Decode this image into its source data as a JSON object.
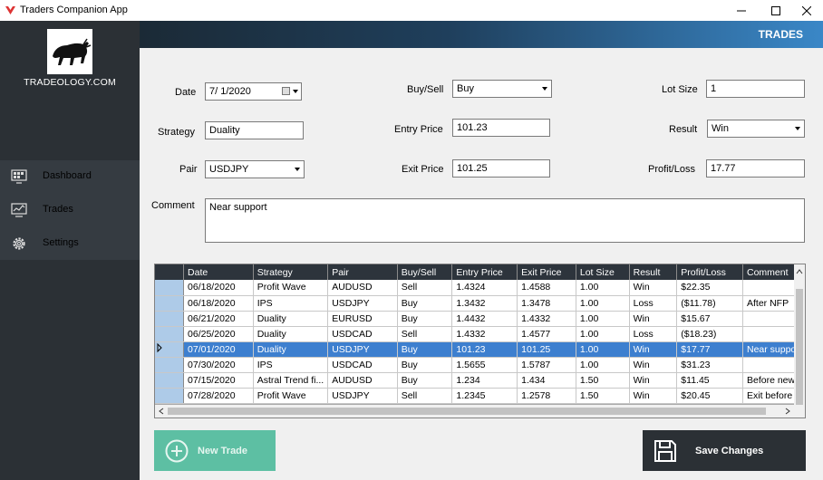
{
  "window": {
    "title": "Traders Companion App"
  },
  "sidebar": {
    "logo_text": "TRADEOLOGY.COM",
    "items": [
      {
        "label": "Dashboard",
        "icon": "dashboard-icon"
      },
      {
        "label": "Trades",
        "icon": "trades-icon"
      },
      {
        "label": "Settings",
        "icon": "gear-icon"
      }
    ]
  },
  "header": {
    "title": "TRADES"
  },
  "form": {
    "date_label": "Date",
    "date_value": "7/  1/2020",
    "strategy_label": "Strategy",
    "strategy_value": "Duality",
    "pair_label": "Pair",
    "pair_value": "USDJPY",
    "buysell_label": "Buy/Sell",
    "buysell_value": "Buy",
    "entry_label": "Entry Price",
    "entry_value": "101.23",
    "exit_label": "Exit Price",
    "exit_value": "101.25",
    "lot_label": "Lot Size",
    "lot_value": "1",
    "result_label": "Result",
    "result_value": "Win",
    "pl_label": "Profit/Loss",
    "pl_value": "17.77",
    "comment_label": "Comment",
    "comment_value": "Near support"
  },
  "grid": {
    "columns": [
      "Date",
      "Strategy",
      "Pair",
      "Buy/Sell",
      "Entry Price",
      "Exit Price",
      "Lot Size",
      "Result",
      "Profit/Loss",
      "Comment"
    ],
    "rows": [
      [
        "06/18/2020",
        "Profit Wave",
        "AUDUSD",
        "Sell",
        "1.4324",
        "1.4588",
        "1.00",
        "Win",
        "$22.35",
        ""
      ],
      [
        "06/18/2020",
        "IPS",
        "USDJPY",
        "Buy",
        "1.3432",
        "1.3478",
        "1.00",
        "Loss",
        "($11.78)",
        "After NFP"
      ],
      [
        "06/21/2020",
        "Duality",
        "EURUSD",
        "Buy",
        "1.4432",
        "1.4332",
        "1.00",
        "Win",
        "$15.67",
        ""
      ],
      [
        "06/25/2020",
        "Duality",
        "USDCAD",
        "Sell",
        "1.4332",
        "1.4577",
        "1.00",
        "Loss",
        "($18.23)",
        ""
      ],
      [
        "07/01/2020",
        "Duality",
        "USDJPY",
        "Buy",
        "101.23",
        "101.25",
        "1.00",
        "Win",
        "$17.77",
        "Near suppor"
      ],
      [
        "07/30/2020",
        "IPS",
        "USDCAD",
        "Buy",
        "1.5655",
        "1.5787",
        "1.00",
        "Win",
        "$31.23",
        ""
      ],
      [
        "07/15/2020",
        "Astral Trend fi...",
        "AUDUSD",
        "Buy",
        "1.234",
        "1.434",
        "1.50",
        "Win",
        "$11.45",
        "Before news"
      ],
      [
        "07/28/2020",
        "Profit Wave",
        "USDJPY",
        "Sell",
        "1.2345",
        "1.2578",
        "1.50",
        "Win",
        "$20.45",
        "Exit before n"
      ]
    ],
    "selected_row": 4
  },
  "buttons": {
    "new_trade": "New Trade",
    "save_changes": "Save Changes"
  },
  "colors": {
    "accent_green": "#5dbfa3",
    "sidebar_dark": "#2b3035",
    "selection_blue": "#3d7fcf"
  }
}
